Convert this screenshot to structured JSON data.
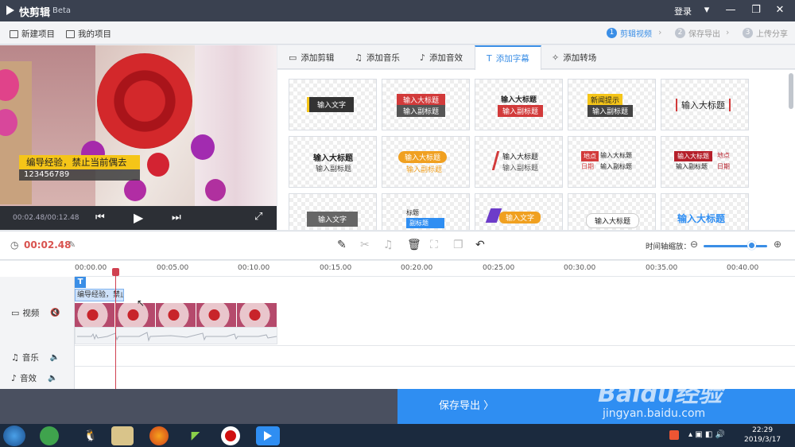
{
  "titlebar": {
    "app_name": "快剪辑",
    "beta": "Beta",
    "login": "登录",
    "icons": [
      "dropdown-icon",
      "minimize-icon",
      "maximize-icon",
      "close-icon"
    ]
  },
  "menubar": {
    "new_project": "新建项目",
    "my_projects": "我的项目"
  },
  "steps": [
    {
      "num": "1",
      "label": "剪辑视频"
    },
    {
      "num": "2",
      "label": "保存导出"
    },
    {
      "num": "3",
      "label": "上传分享"
    }
  ],
  "preview": {
    "subtitle_main": "编导经验，禁止当前偶去",
    "subtitle_secondary": "123456789",
    "timecode": "00:02.48/00:12.48"
  },
  "tabs": [
    {
      "label": "添加剪辑",
      "icon": "film-icon"
    },
    {
      "label": "添加音乐",
      "icon": "music-icon"
    },
    {
      "label": "添加音效",
      "icon": "sound-effect-icon"
    },
    {
      "label": "添加字幕",
      "icon": "text-icon"
    },
    {
      "label": "添加转场",
      "icon": "transition-icon"
    }
  ],
  "templates": {
    "r1": [
      {
        "a": "输入文字"
      },
      {
        "a": "输入大标题",
        "b": "输入副标题"
      },
      {
        "a": "输入大标题",
        "b": "输入副标题"
      },
      {
        "a": "新闻提示",
        "b": "输入副标题"
      },
      {
        "a": "输入大标题"
      }
    ],
    "r2": [
      {
        "a": "输入大标题",
        "b": "输入副标题"
      },
      {
        "a": "输入大标题",
        "b": "输入副标题"
      },
      {
        "a": "输入大标题",
        "b": "输入副标题"
      },
      {
        "a": "地点",
        "b": "日期",
        "c": "输入大标题",
        "d": "输入副标题"
      },
      {
        "a": "输入大标题",
        "b": "地点",
        "c": "日期",
        "d": "输入副标题"
      }
    ],
    "r3": [
      {
        "a": "输入文字"
      },
      {
        "a": "标题",
        "b": "副标题"
      },
      {
        "a": "输入文字"
      },
      {
        "a": "输入大标题"
      },
      {
        "a": "输入大标题"
      }
    ]
  },
  "toolbar": {
    "current_time": "00:02.48",
    "zoom_label": "时间轴缩放："
  },
  "timeline": {
    "ruler": [
      "00:00.00",
      "00:05.00",
      "00:10.00",
      "00:15.00",
      "00:20.00",
      "00:25.00",
      "00:30.00",
      "00:35.00",
      "00:40.00"
    ],
    "text_clip_icon": "T",
    "text_clip": "编导经验，禁止",
    "tracks": {
      "video": "视频",
      "music": "音乐",
      "effects": "音效"
    }
  },
  "save": {
    "label": "保存导出 〉"
  },
  "watermark": {
    "brand": "Baidu经验",
    "url": "jingyan.baidu.com"
  },
  "taskbar": {
    "time": "22:29",
    "date": "2019/3/17"
  },
  "colors": {
    "accent": "#3a8ee6",
    "title_bg": "#3a4150",
    "save": "#2f8ef2",
    "time_red": "#d9534f"
  }
}
